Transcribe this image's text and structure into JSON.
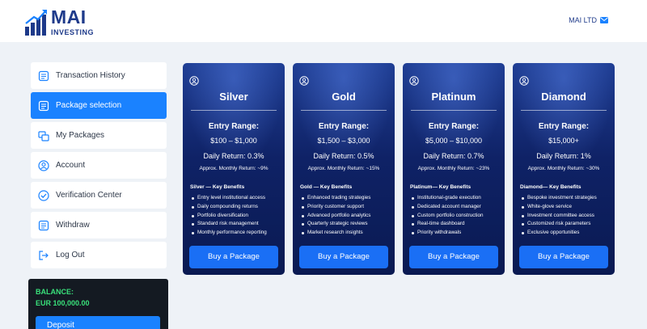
{
  "header": {
    "logo_main": "MAI",
    "logo_sub": "INVESTING",
    "user_label": "MAI LTD"
  },
  "sidebar": {
    "items": [
      {
        "label": "Transaction History",
        "icon": "list-icon",
        "active": false
      },
      {
        "label": "Package selection",
        "icon": "list-icon",
        "active": true
      },
      {
        "label": "My Packages",
        "icon": "packages-icon",
        "active": false
      },
      {
        "label": "Account",
        "icon": "user-icon",
        "active": false
      },
      {
        "label": "Verification Center",
        "icon": "check-circle-icon",
        "active": false
      },
      {
        "label": "Withdraw",
        "icon": "list-icon",
        "active": false
      },
      {
        "label": "Log Out",
        "icon": "logout-icon",
        "active": false
      }
    ]
  },
  "balance": {
    "label": "BALANCE:",
    "value": "EUR 100,000.00",
    "button_label": "Deposit"
  },
  "packages": [
    {
      "title": "Silver",
      "entry_label": "Entry Range:",
      "entry_range": "$100 – $1,000",
      "daily_return": "Daily Return: 0.3%",
      "monthly_return": "Approx. Monthly Return: ~9%",
      "benefits_title": "Silver — Key Benefits",
      "benefits": [
        "Entry level institutional access",
        "Daily compounding returns",
        "Portfolio diversification",
        "Standard risk management",
        "Monthly performance reporting"
      ],
      "button_label": "Buy a Package"
    },
    {
      "title": "Gold",
      "entry_label": "Entry Range:",
      "entry_range": "$1,500 – $3,000",
      "daily_return": "Daily Return: 0.5%",
      "monthly_return": "Approx. Monthly Return: ~15%",
      "benefits_title": "Gold — Key Benefits",
      "benefits": [
        "Enhanced trading strategies",
        "Priority customer support",
        "Advanced portfolio analytics",
        "Quarterly strategic reviews",
        "Market research insights"
      ],
      "button_label": "Buy a Package"
    },
    {
      "title": "Platinum",
      "entry_label": "Entry Range:",
      "entry_range": "$5,000 – $10,000",
      "daily_return": "Daily Return: 0.7%",
      "monthly_return": "Approx. Monthly Return: ~23%",
      "benefits_title": "Platinum— Key Benefits",
      "benefits": [
        "Institutional-grade execution",
        "Dedicated account manager",
        "Custom portfolio construction",
        "Real-time dashboard",
        "Priority withdrawals"
      ],
      "button_label": "Buy a Package"
    },
    {
      "title": "Diamond",
      "entry_label": "Entry Range:",
      "entry_range": "$15,000+",
      "daily_return": "Daily Return: 1%",
      "monthly_return": "Approx. Monthly Return: ~30%",
      "benefits_title": "Diamond— Key Benefits",
      "benefits": [
        "Bespoke investment strategies",
        "White-glove service",
        "Investment committee access",
        "Customized risk parameters",
        "Exclusive opportunities"
      ],
      "button_label": "Buy a Package"
    }
  ],
  "colors": {
    "brand": "#1e3a8a",
    "accent": "#1a82ff",
    "balance_text": "#39e07a"
  }
}
